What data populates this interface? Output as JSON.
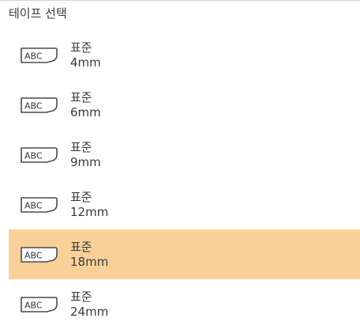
{
  "panel": {
    "title": "테이프 선택"
  },
  "tape_icon_text": "ABC",
  "items": [
    {
      "type": "표준",
      "size": "4mm",
      "selected": false
    },
    {
      "type": "표준",
      "size": "6mm",
      "selected": false
    },
    {
      "type": "표준",
      "size": "9mm",
      "selected": false
    },
    {
      "type": "표준",
      "size": "12mm",
      "selected": false
    },
    {
      "type": "표준",
      "size": "18mm",
      "selected": true
    },
    {
      "type": "표준",
      "size": "24mm",
      "selected": false
    }
  ],
  "colors": {
    "selected_background": "#f9d198",
    "text": "#3a3a3a",
    "icon_stroke": "#4a4a4a"
  },
  "icons": {
    "tape": "tape-cartridge-icon"
  }
}
